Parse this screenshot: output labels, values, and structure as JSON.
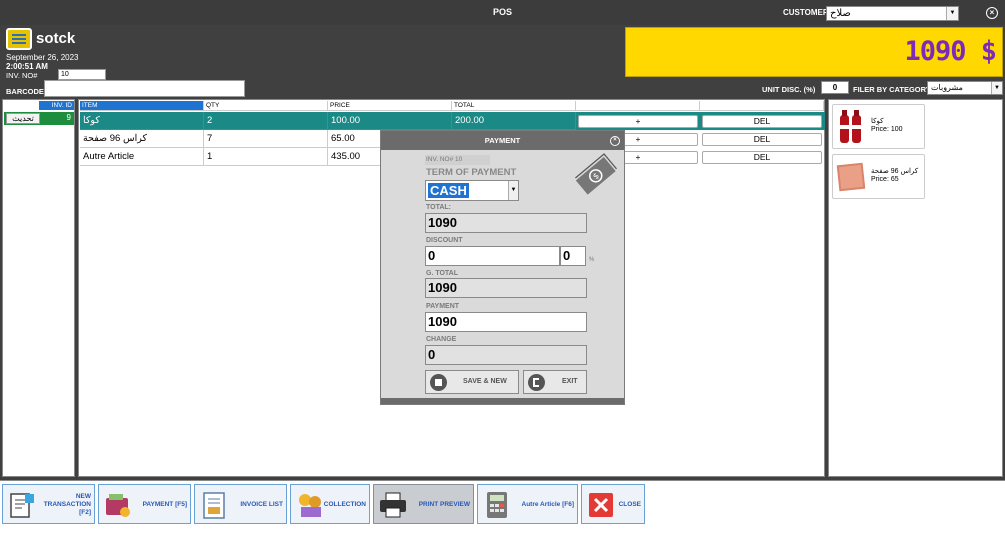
{
  "window": {
    "title": "POS",
    "customer_label": "CUSTOMER",
    "customer_value": "صلاح"
  },
  "header": {
    "brand": "sotck",
    "date": "September 26, 2023",
    "time": "2:00:51 AM",
    "inv_no_label": "INV. NO#",
    "inv_no_value": "10",
    "barcode_label": "BARCODE",
    "total_display": "1090 $",
    "unit_disc_label": "UNIT DISC. (%)",
    "unit_disc_value": "0",
    "filter_label": "FILER BY CATEGORY",
    "category_value": "مشروبات"
  },
  "left_panel": {
    "header": "INV. ID",
    "refresh_label": "تحديث",
    "id_value": "9"
  },
  "grid": {
    "columns": [
      "ITEM",
      "QTY",
      "PRICE",
      "TOTAL"
    ],
    "rows": [
      {
        "item": "كوكا",
        "qty": "2",
        "price": "100.00",
        "total": "200.00",
        "plus": "+",
        "del": "DEL"
      },
      {
        "item": "كراس 96 صفحة",
        "qty": "7",
        "price": "65.00",
        "total": "",
        "plus": "+",
        "del": "DEL"
      },
      {
        "item": "Autre Article",
        "qty": "1",
        "price": "435.00",
        "total": "",
        "plus": "+",
        "del": "DEL"
      }
    ]
  },
  "products": [
    {
      "name": "كوكا",
      "price": "Price: 100"
    },
    {
      "name": "كراس 96 صفحة",
      "price": "Price: 65"
    }
  ],
  "toolbar": {
    "new_transaction": "NEW TRANSACTION [F2]",
    "payment": "PAYMENT [F5]",
    "invoice_list": "INVOICE LIST",
    "collection": "COLLECTION",
    "print_preview": "PRINT PREVIEW",
    "autre_article": "Autre Article [F6]",
    "close": "CLOSE"
  },
  "payment_dialog": {
    "title": "PAYMENT",
    "inv_no": "INV. NO# 10",
    "term_label": "TERM OF PAYMENT",
    "term_value": "CASH",
    "total_label": "TOTAL:",
    "total_value": "1090",
    "discount_label": "DISCOUNT",
    "discount_value": "0",
    "discount_pct": "0",
    "pct_symbol": "%",
    "gtotal_label": "G. TOTAL",
    "gtotal_value": "1090",
    "payment_label": "PAYMENT",
    "payment_value": "1090",
    "change_label": "CHANGE",
    "change_value": "0",
    "save_label": "SAVE & NEW",
    "exit_label": "EXIT"
  },
  "colors": {
    "accent_yellow": "#ffd800",
    "total_text": "#7c2bb9",
    "active_row": "#1b8a86",
    "selection_blue": "#1f73d1",
    "id_green": "#1e8e3e"
  }
}
